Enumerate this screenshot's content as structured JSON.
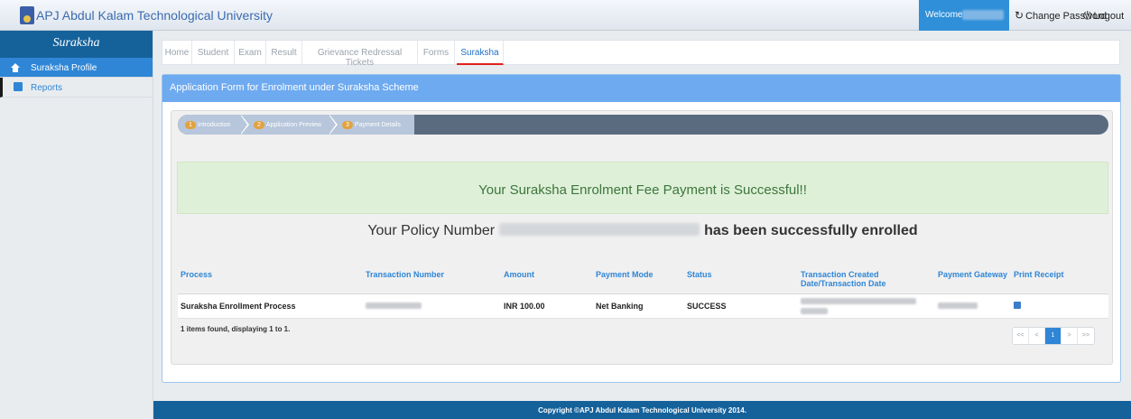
{
  "header": {
    "app_title": "APJ Abdul Kalam Technological University",
    "welcome": "Welcome",
    "change_password": "Change Password",
    "logout": "Logout"
  },
  "sidebar": {
    "title": "Suraksha",
    "items": [
      {
        "label": "Suraksha Profile"
      },
      {
        "label": "Reports"
      }
    ]
  },
  "tabs": [
    "Home",
    "Student",
    "Exam",
    "Result",
    "Grievance Redressal Tickets",
    "Forms",
    "Suraksha"
  ],
  "panel": {
    "title": "Application Form for Enrolment under Suraksha Scheme",
    "steps": [
      {
        "num": "1",
        "label": "Introduction"
      },
      {
        "num": "2",
        "label": "Application Preview"
      },
      {
        "num": "3",
        "label": "Payment Details"
      }
    ],
    "success_message": "Your Suraksha Enrolment Fee Payment is Successful!!",
    "policy_prefix": "Your Policy Number",
    "policy_suffix": "has been successfully enrolled"
  },
  "table": {
    "headers": [
      "Process",
      "Transaction Number",
      "Amount",
      "Payment Mode",
      "Status",
      "Transaction Created Date/Transaction Date",
      "Payment Gateway",
      "Print Receipt"
    ],
    "row": {
      "process": "Suraksha Enrollment Process",
      "amount": "INR 100.00",
      "payment_mode": "Net Banking",
      "status": "SUCCESS"
    },
    "found_text": "1 items found, displaying 1 to 1."
  },
  "pagination": {
    "first": "<<",
    "prev": "<",
    "current": "1",
    "next": ">",
    "last": ">>"
  },
  "footer": {
    "copyright": "Copyright ©APJ Abdul Kalam Technological University 2014."
  },
  "colors": {
    "primary": "#2f86d6",
    "header_dark": "#15629b",
    "success_bg": "#dff0d8",
    "success_text": "#3c763d",
    "active_tab_underline": "#e02020"
  }
}
